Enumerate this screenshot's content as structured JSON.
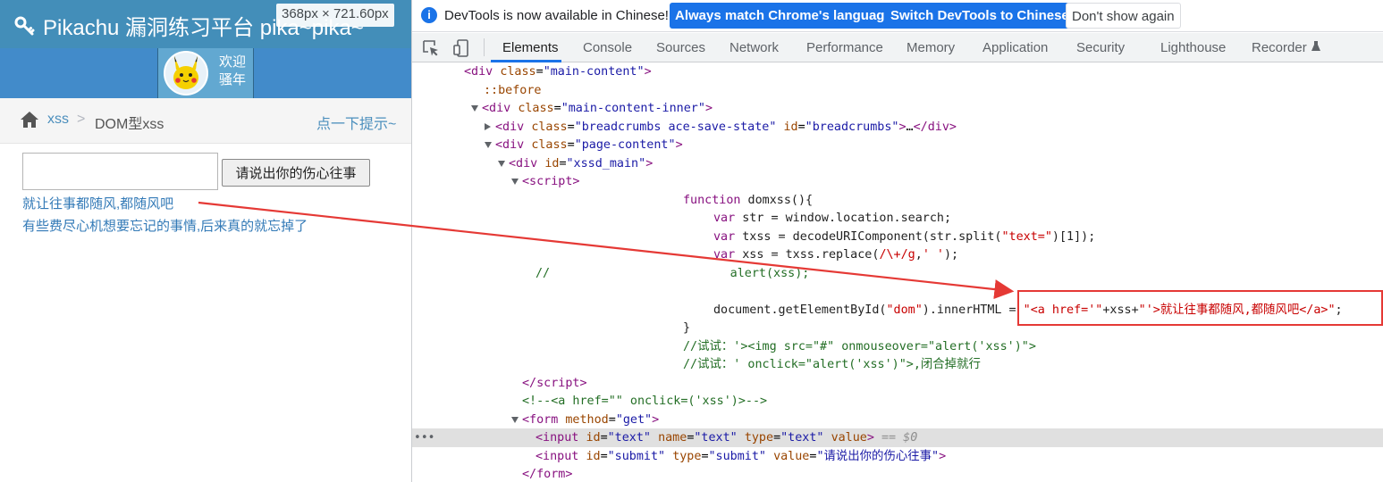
{
  "left_page": {
    "brand": "Pikachu 漏洞练习平台 pika~pika~",
    "size_badge": "368px × 721.60px",
    "welcome_line1": "欢迎",
    "welcome_line2": "骚年",
    "breadcrumb": {
      "section": "xss",
      "separator": ">",
      "current": "DOM型xss",
      "hint": "点一下提示~"
    },
    "form": {
      "text_value": "",
      "submit_label": "请说出你的伤心往事"
    },
    "dom_link": "就让往事都随风,都随风吧",
    "forget_text": "有些费尽心机想要忘记的事情,后来真的就忘掉了"
  },
  "devtools": {
    "infobar": {
      "message": "DevTools is now available in Chinese!",
      "match_button": "Always match Chrome's language",
      "switch_button": "Switch DevTools to Chinese",
      "dont_button": "Don't show again"
    },
    "tabs": [
      "Elements",
      "Console",
      "Sources",
      "Network",
      "Performance",
      "Memory",
      "Application",
      "Security",
      "Lighthouse",
      "Recorder"
    ],
    "active_tab": "Elements",
    "dom_lines": [
      {
        "indent": 58,
        "tri": "",
        "html": "<span class=\"tag\">&lt;div</span> <span class=\"attr\">class</span>=<span class=\"val\">\"main-content\"</span><span class=\"tag\">&gt;</span>"
      },
      {
        "indent": 80,
        "tri": "",
        "html": "<span class=\"attr\">::before</span>"
      },
      {
        "indent": 78,
        "tri": "open",
        "html": "<span class=\"tag\">&lt;div</span> <span class=\"attr\">class</span>=<span class=\"val\">\"main-content-inner\"</span><span class=\"tag\">&gt;</span>"
      },
      {
        "indent": 93,
        "tri": "closed",
        "html": "<span class=\"tag\">&lt;div</span> <span class=\"attr\">class</span>=<span class=\"val\">\"breadcrumbs ace-save-state\"</span> <span class=\"attr\">id</span>=<span class=\"val\">\"breadcrumbs\"</span><span class=\"tag\">&gt;</span>…<span class=\"tag\">&lt;/div&gt;</span>"
      },
      {
        "indent": 93,
        "tri": "open",
        "html": "<span class=\"tag\">&lt;div</span> <span class=\"attr\">class</span>=<span class=\"val\">\"page-content\"</span><span class=\"tag\">&gt;</span>"
      },
      {
        "indent": 108,
        "tri": "open",
        "html": "<span class=\"tag\">&lt;div</span> <span class=\"attr\">id</span>=<span class=\"val\">\"xssd_main\"</span><span class=\"tag\">&gt;</span>"
      },
      {
        "indent": 123,
        "tri": "open",
        "html": "<span class=\"tag\">&lt;script&gt;</span>"
      },
      {
        "indent": 303,
        "tri": "",
        "html": "<span class=\"kw\">function</span><span class=\"plain\"> domxss(){</span>"
      },
      {
        "indent": 337,
        "tri": "",
        "html": "<span class=\"kw\">var</span><span class=\"plain\"> str = window.location.search;</span>"
      },
      {
        "indent": 337,
        "tri": "",
        "html": "<span class=\"kw\">var</span><span class=\"plain\"> txss = decodeURIComponent(str.split(</span><span class=\"str\">\"text=\"</span><span class=\"plain\">)[1]);</span>"
      },
      {
        "indent": 337,
        "tri": "",
        "html": "<span class=\"kw\">var</span><span class=\"plain\"> xss = txss.replace(</span><span class=\"str\">/\\+/g</span><span class=\"plain\">,</span><span class=\"str\">' '</span><span class=\"plain\">);</span>"
      },
      {
        "indent": 138,
        "tri": "",
        "html": "<span class=\"cmt\">//                         alert(xss);</span>"
      },
      {
        "indent": 0,
        "tri": "",
        "html": ""
      },
      {
        "indent": 337,
        "tri": "",
        "html": "<span class=\"plain\">document.getElementById(</span><span class=\"str\">\"dom\"</span><span class=\"plain\">).innerHTML = </span><span class=\"str\">\"&lt;a href='\"</span><span class=\"plain\">+xss+</span><span class=\"str\">\"'&gt;就让往事都随风,都随风吧&lt;/a&gt;\"</span><span class=\"plain\">;</span>"
      },
      {
        "indent": 303,
        "tri": "",
        "html": "<span class=\"plain\">}</span>"
      },
      {
        "indent": 303,
        "tri": "",
        "html": "<span class=\"cmt\">//试试：'&gt;&lt;img src=\"#\" onmouseover=\"alert('xss')\"&gt;</span>"
      },
      {
        "indent": 303,
        "tri": "",
        "html": "<span class=\"cmt\">//试试：' onclick=\"alert('xss')\"&gt;,闭合掉就行</span>"
      },
      {
        "indent": 123,
        "tri": "",
        "html": "<span class=\"tag\">&lt;/script&gt;</span>"
      },
      {
        "indent": 123,
        "tri": "",
        "html": "<span class=\"cmt\">&lt;!--&lt;a href=\"\" onclick=('xss')&gt;--&gt;</span>"
      },
      {
        "indent": 123,
        "tri": "open",
        "html": "<span class=\"tag\">&lt;form</span> <span class=\"attr\">method</span>=<span class=\"val\">\"get\"</span><span class=\"tag\">&gt;</span>"
      },
      {
        "indent": 138,
        "tri": "",
        "html": "<span class=\"tag\">&lt;input</span> <span class=\"attr\">id</span>=<span class=\"val\">\"text\"</span> <span class=\"attr\">name</span>=<span class=\"val\">\"text\"</span> <span class=\"attr\">type</span>=<span class=\"val\">\"text\"</span> <span class=\"attr\">value</span><span class=\"tag\">&gt;</span> <span class=\"dim\">== $0</span>",
        "selected": true
      },
      {
        "indent": 138,
        "tri": "",
        "html": "<span class=\"tag\">&lt;input</span> <span class=\"attr\">id</span>=<span class=\"val\">\"submit\"</span> <span class=\"attr\">type</span>=<span class=\"val\">\"submit\"</span> <span class=\"attr\">value</span>=<span class=\"val\">\"请说出你的伤心往事\"</span><span class=\"tag\">&gt;</span>"
      },
      {
        "indent": 123,
        "tri": "",
        "html": "<span class=\"tag\">&lt;/form&gt;</span>"
      }
    ]
  },
  "colors": {
    "topbar": "#438eb9",
    "userbar": "#428bca",
    "link": "#337ab7",
    "devtools_accent": "#1a73e8",
    "annotation_red": "#e53935"
  },
  "icons": [
    "key-icon",
    "home-icon",
    "info-icon",
    "inspect-icon",
    "device-toolbar-icon",
    "flask-icon",
    "pikachu-avatar"
  ]
}
